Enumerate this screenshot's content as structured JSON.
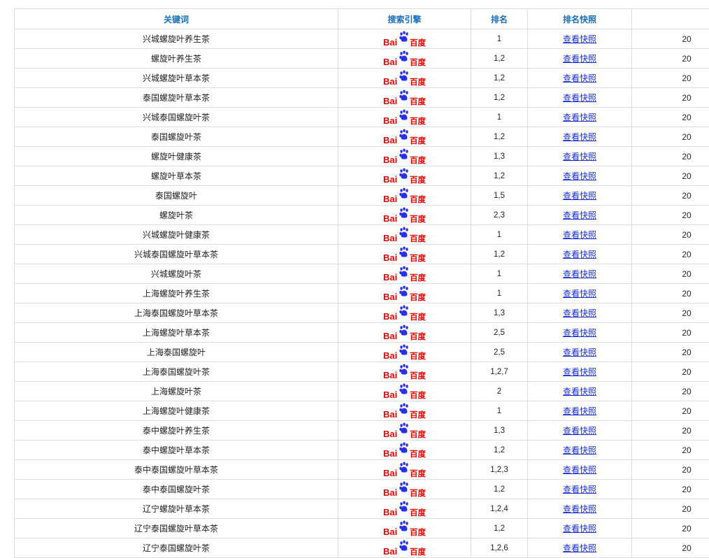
{
  "headers": {
    "keyword": "关键词",
    "engine": "搜索引擎",
    "rank": "排名",
    "snapshot": "排名快照",
    "date": ""
  },
  "engine_logo": {
    "name": "baidu-logo",
    "text_latin": "Bai",
    "text_cn": "百度",
    "red": "#e10601",
    "blue": "#2932e1"
  },
  "rows": [
    {
      "keyword": "兴城螺旋叶养生茶",
      "rank": "1",
      "snapshot": "查看快照",
      "date": "20"
    },
    {
      "keyword": "螺旋叶养生茶",
      "rank": "1,2",
      "snapshot": "查看快照",
      "date": "20"
    },
    {
      "keyword": "兴城螺旋叶草本茶",
      "rank": "1,2",
      "snapshot": "查看快照",
      "date": "20"
    },
    {
      "keyword": "泰国螺旋叶草本茶",
      "rank": "1,2",
      "snapshot": "查看快照",
      "date": "20"
    },
    {
      "keyword": "兴城泰国螺旋叶茶",
      "rank": "1",
      "snapshot": "查看快照",
      "date": "20"
    },
    {
      "keyword": "泰国螺旋叶茶",
      "rank": "1,2",
      "snapshot": "查看快照",
      "date": "20"
    },
    {
      "keyword": "螺旋叶健康茶",
      "rank": "1,3",
      "snapshot": "查看快照",
      "date": "20"
    },
    {
      "keyword": "螺旋叶草本茶",
      "rank": "1,2",
      "snapshot": "查看快照",
      "date": "20"
    },
    {
      "keyword": "泰国螺旋叶",
      "rank": "1,5",
      "snapshot": "查看快照",
      "date": "20"
    },
    {
      "keyword": "螺旋叶茶",
      "rank": "2,3",
      "snapshot": "查看快照",
      "date": "20"
    },
    {
      "keyword": "兴城螺旋叶健康茶",
      "rank": "1",
      "snapshot": "查看快照",
      "date": "20"
    },
    {
      "keyword": "兴城泰国螺旋叶草本茶",
      "rank": "1,2",
      "snapshot": "查看快照",
      "date": "20"
    },
    {
      "keyword": "兴城螺旋叶茶",
      "rank": "1",
      "snapshot": "查看快照",
      "date": "20"
    },
    {
      "keyword": "上海螺旋叶养生茶",
      "rank": "1",
      "snapshot": "查看快照",
      "date": "20"
    },
    {
      "keyword": "上海泰国螺旋叶草本茶",
      "rank": "1,3",
      "snapshot": "查看快照",
      "date": "20"
    },
    {
      "keyword": "上海螺旋叶草本茶",
      "rank": "2,5",
      "snapshot": "查看快照",
      "date": "20"
    },
    {
      "keyword": "上海泰国螺旋叶",
      "rank": "2,5",
      "snapshot": "查看快照",
      "date": "20"
    },
    {
      "keyword": "上海泰国螺旋叶茶",
      "rank": "1,2,7",
      "snapshot": "查看快照",
      "date": "20"
    },
    {
      "keyword": "上海螺旋叶茶",
      "rank": "2",
      "snapshot": "查看快照",
      "date": "20"
    },
    {
      "keyword": "上海螺旋叶健康茶",
      "rank": "1",
      "snapshot": "查看快照",
      "date": "20"
    },
    {
      "keyword": "泰中螺旋叶养生茶",
      "rank": "1,3",
      "snapshot": "查看快照",
      "date": "20"
    },
    {
      "keyword": "泰中螺旋叶草本茶",
      "rank": "1,2",
      "snapshot": "查看快照",
      "date": "20"
    },
    {
      "keyword": "泰中泰国螺旋叶草本茶",
      "rank": "1,2,3",
      "snapshot": "查看快照",
      "date": "20"
    },
    {
      "keyword": "泰中泰国螺旋叶茶",
      "rank": "1,2",
      "snapshot": "查看快照",
      "date": "20"
    },
    {
      "keyword": "辽宁螺旋叶草本茶",
      "rank": "1,2,4",
      "snapshot": "查看快照",
      "date": "20"
    },
    {
      "keyword": "辽宁泰国螺旋叶草本茶",
      "rank": "1,2",
      "snapshot": "查看快照",
      "date": "20"
    },
    {
      "keyword": "辽宁泰国螺旋叶茶",
      "rank": "1,2,6",
      "snapshot": "查看快照",
      "date": "20"
    }
  ]
}
